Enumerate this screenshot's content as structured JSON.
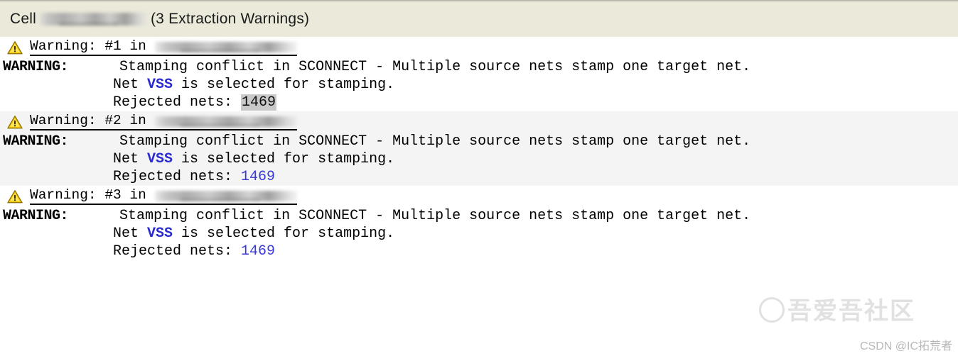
{
  "header": {
    "prefix": "Cell",
    "cell_name_redacted": true,
    "suffix": "(3 Extraction Warnings)",
    "background_color": "#ebe9da"
  },
  "icons": {
    "warning": "warning-triangle-icon"
  },
  "colors": {
    "net_name": "#2a2ad0",
    "rejected_link": "#3a3ad8",
    "selection_highlight": "#c9c9c9",
    "shaded_row": "#f4f4f4"
  },
  "warnings": [
    {
      "head_prefix": "Warning: #1 in",
      "head_location_redacted": true,
      "label": "WARNING:",
      "message": "Stamping conflict in SCONNECT - Multiple source nets stamp one target net.",
      "net_line_pre": "Net ",
      "net_name": "VSS",
      "net_line_post": " is selected for stamping.",
      "rejected_label": "Rejected nets: ",
      "rejected_value": "1469",
      "rejected_selected": true,
      "shaded": false
    },
    {
      "head_prefix": "Warning: #2 in",
      "head_location_redacted": true,
      "label": "WARNING:",
      "message": "Stamping conflict in SCONNECT - Multiple source nets stamp one target net.",
      "net_line_pre": "Net ",
      "net_name": "VSS",
      "net_line_post": " is selected for stamping.",
      "rejected_label": "Rejected nets: ",
      "rejected_value": "1469",
      "rejected_selected": false,
      "shaded": true
    },
    {
      "head_prefix": "Warning: #3 in",
      "head_location_redacted": true,
      "label": "WARNING:",
      "message": "Stamping conflict in SCONNECT - Multiple source nets stamp one target net.",
      "net_line_pre": "Net ",
      "net_name": "VSS",
      "net_line_post": " is selected for stamping.",
      "rejected_label": "Rejected nets: ",
      "rejected_value": "1469",
      "rejected_selected": false,
      "shaded": false
    }
  ],
  "watermark": {
    "chinese": "吾爱吾社区",
    "attribution": "CSDN @IC拓荒者"
  }
}
